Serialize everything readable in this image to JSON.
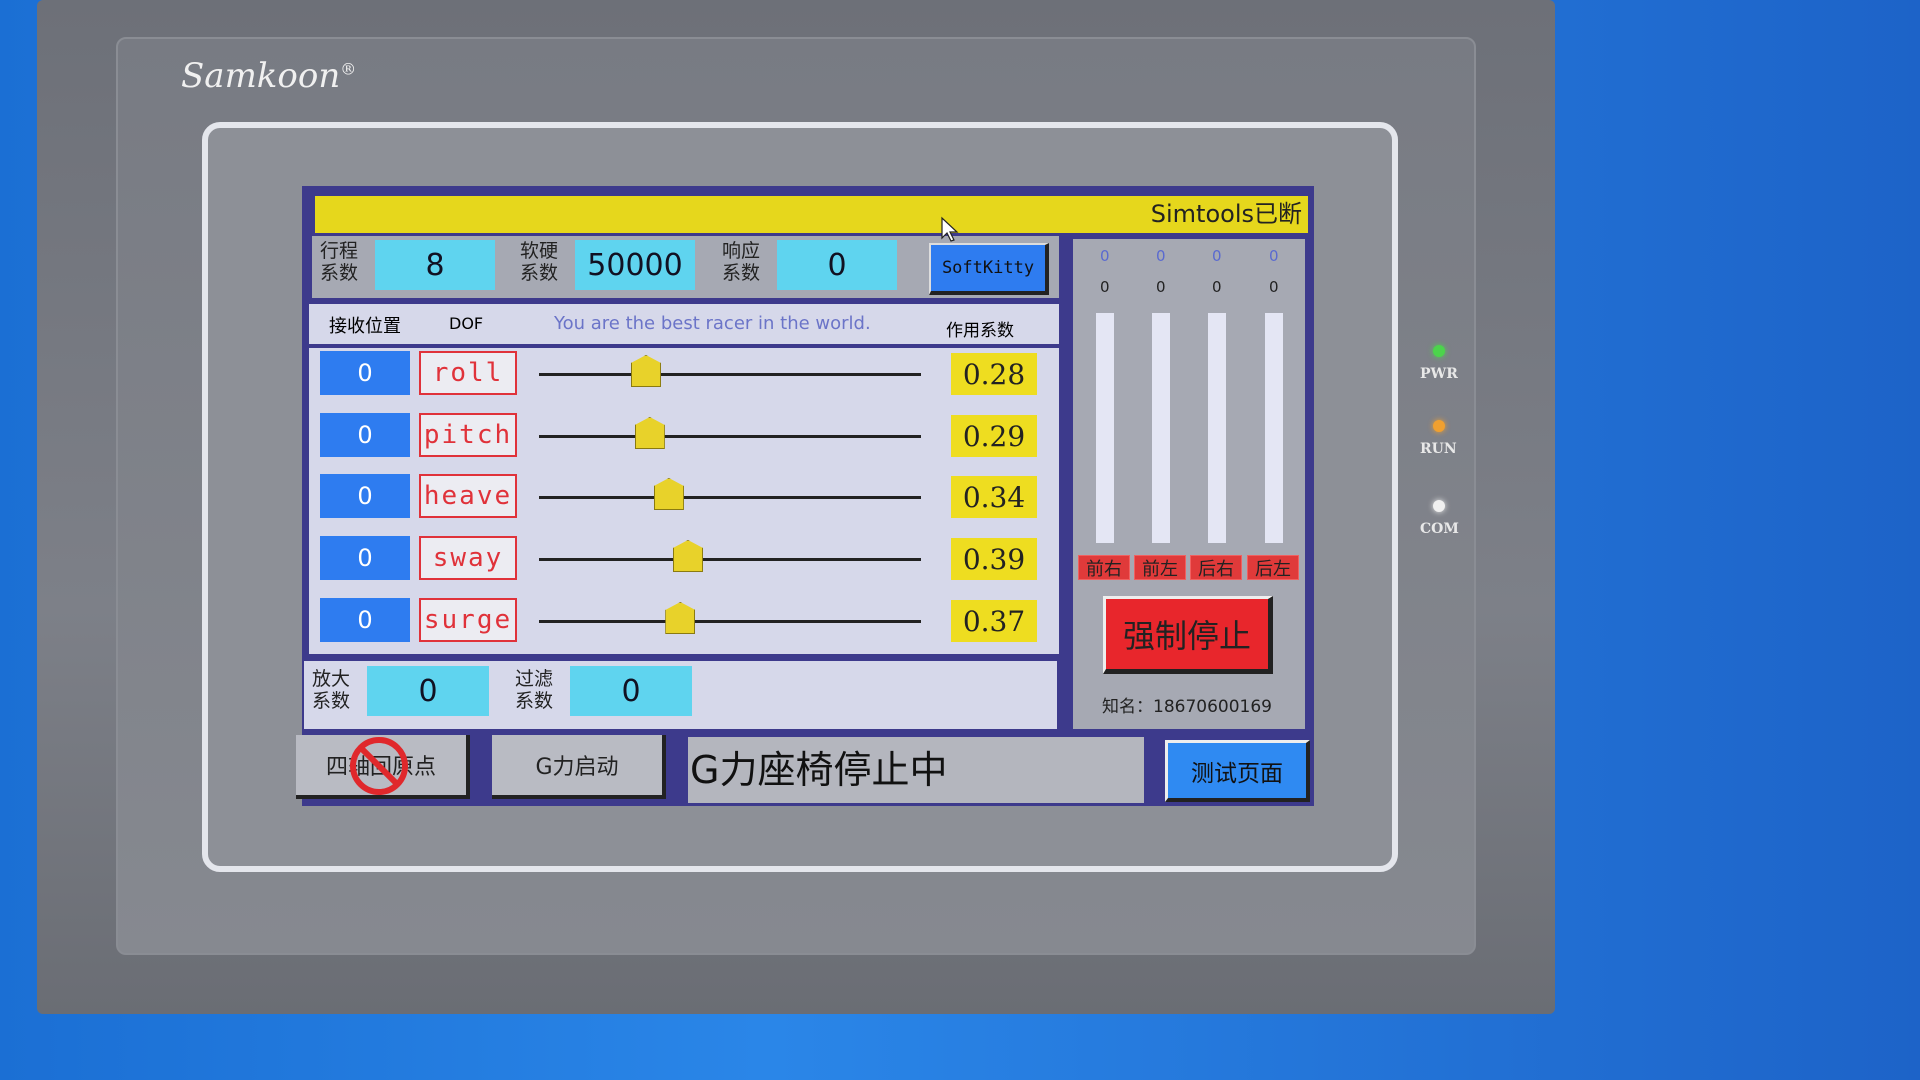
{
  "brand": "Samkoon",
  "brand_mark": "®",
  "leds": [
    {
      "label": "PWR",
      "color": "#4cd44c"
    },
    {
      "label": "RUN",
      "color": "#f0a030"
    },
    {
      "label": "COM",
      "color": "#f0f0f0"
    }
  ],
  "status_bar": "Simtools已断",
  "params": [
    {
      "label1": "行程",
      "label2": "系数",
      "value": "8"
    },
    {
      "label1": "软硬",
      "label2": "系数",
      "value": "50000"
    },
    {
      "label1": "响应",
      "label2": "系数",
      "value": "0"
    }
  ],
  "softkitty_label": "SoftKitty",
  "table": {
    "col_position": "接收位置",
    "col_dof": "DOF",
    "slogan": "You are the best racer in the world.",
    "col_coef": "作用系数",
    "rows": [
      {
        "position": "0",
        "dof": "roll",
        "coef": "0.28",
        "slider": 0.28
      },
      {
        "position": "0",
        "dof": "pitch",
        "coef": "0.29",
        "slider": 0.29
      },
      {
        "position": "0",
        "dof": "heave",
        "coef": "0.34",
        "slider": 0.34
      },
      {
        "position": "0",
        "dof": "sway",
        "coef": "0.39",
        "slider": 0.39
      },
      {
        "position": "0",
        "dof": "surge",
        "coef": "0.37",
        "slider": 0.37
      }
    ]
  },
  "bottom_params": [
    {
      "label1": "放大",
      "label2": "系数",
      "value": "0"
    },
    {
      "label1": "过滤",
      "label2": "系数",
      "value": "0"
    }
  ],
  "axes": [
    {
      "top": "0",
      "value": "0",
      "label": "前右"
    },
    {
      "top": "0",
      "value": "0",
      "label": "前左"
    },
    {
      "top": "0",
      "value": "0",
      "label": "后右"
    },
    {
      "top": "0",
      "value": "0",
      "label": "后左"
    }
  ],
  "force_stop": "强制停止",
  "contact": "知名：18670600169",
  "buttons": {
    "home": "四轴回原点",
    "g_start": "G力启动",
    "status": "G力座椅停止中",
    "test": "测试页面"
  }
}
